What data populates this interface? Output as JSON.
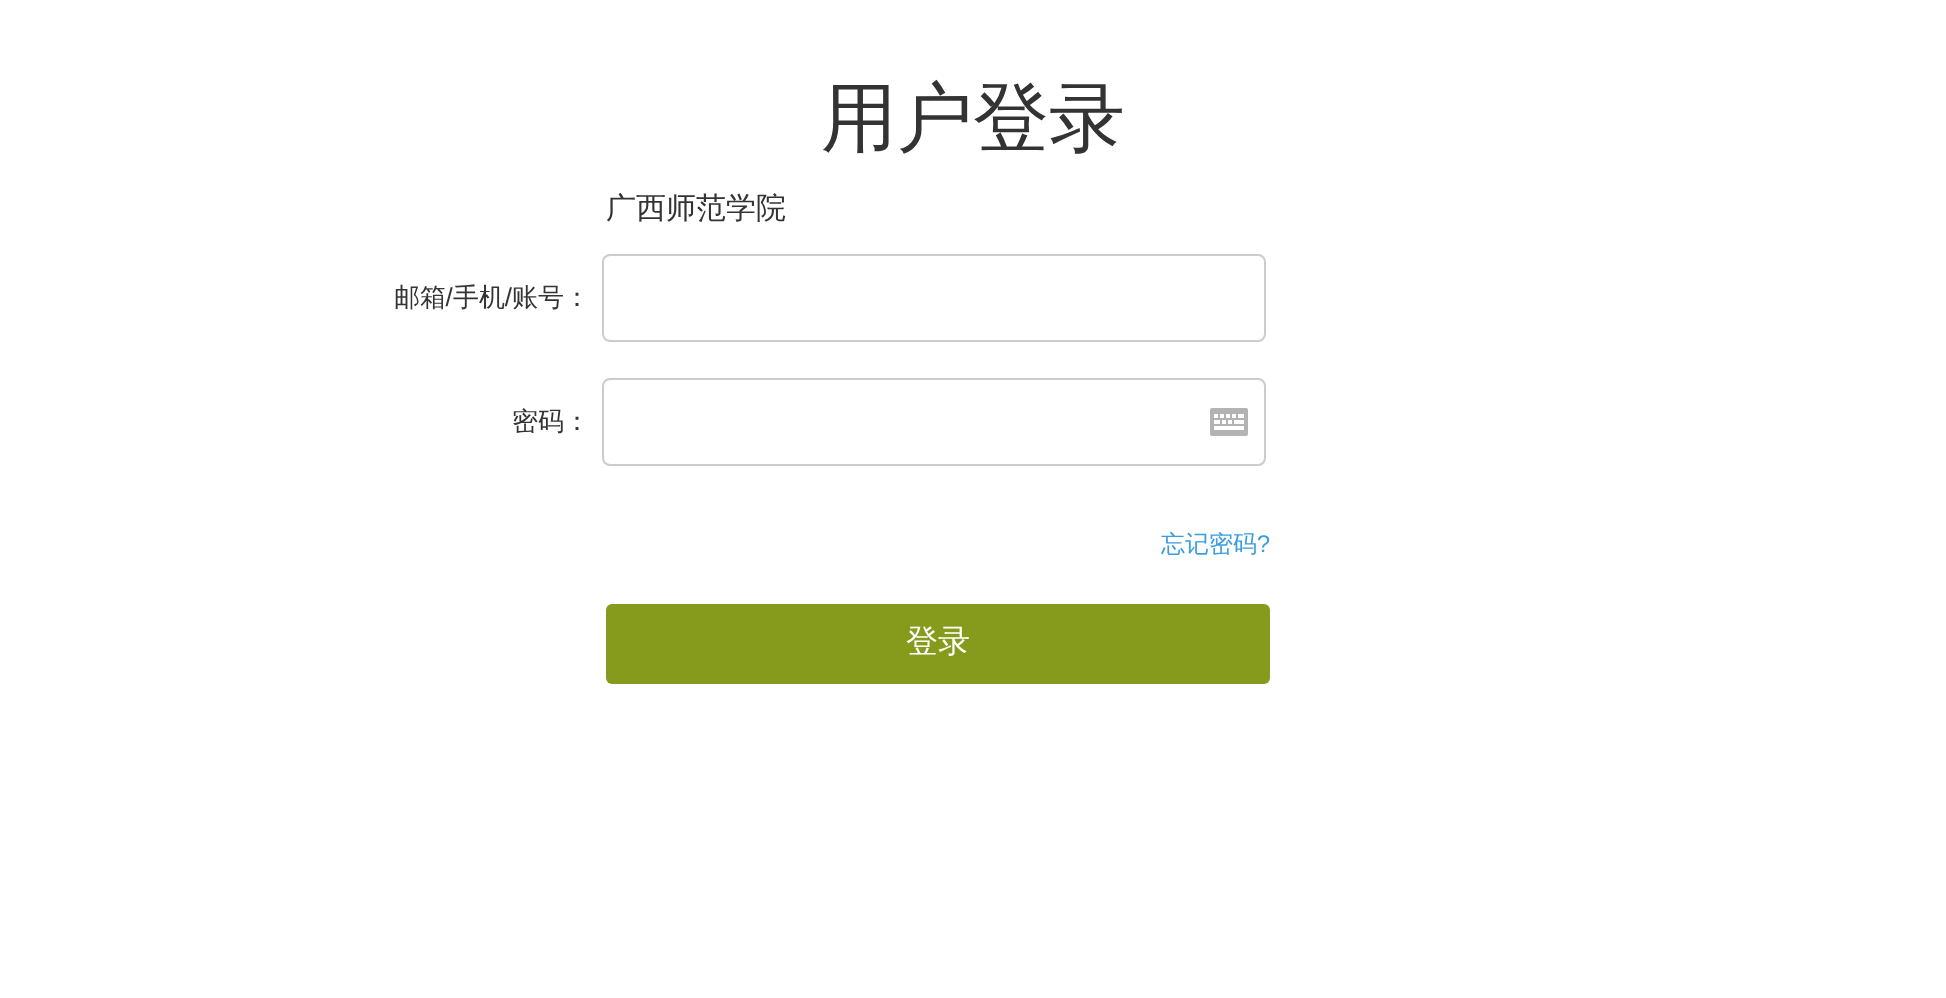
{
  "title": "用户登录",
  "school": "广西师范学院",
  "fields": [
    {
      "kind": "text",
      "label": "邮箱/手机/账号："
    },
    {
      "kind": "password",
      "label": "密码："
    }
  ],
  "forgot_link": "忘记密码?",
  "login_button": "登录"
}
